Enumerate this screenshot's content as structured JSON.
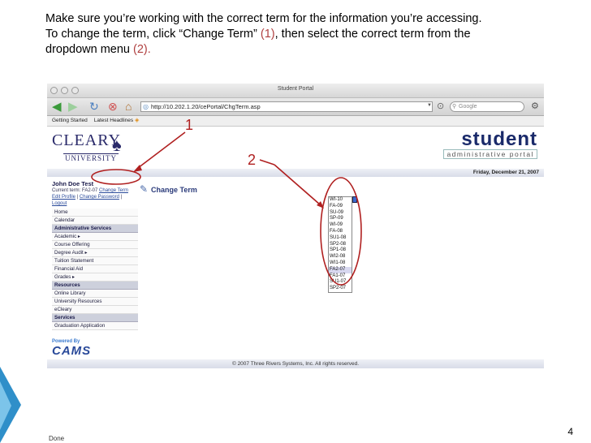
{
  "instructions": {
    "line1": "Make sure you’re working with the correct term for the information you’re accessing.",
    "line2_pre": "To change the term, click “Change Term” ",
    "line2_ref1": "(1)",
    "line2_post": ", then select the correct term from the",
    "line3_pre": "dropdown menu ",
    "line3_ref2": "(2)."
  },
  "browser": {
    "window_title": "Student Portal",
    "url": "http://10.202.1.20/cePortal/ChgTerm.asp",
    "search_placeholder": "Google",
    "bookmarks": [
      "Getting Started",
      "Latest Headlines"
    ],
    "status": "Done"
  },
  "portal": {
    "logo_name": "CLEARY",
    "logo_sub": "UNIVERSITY",
    "brand_title": "student",
    "brand_subtitle": "administrative portal",
    "date": "Friday, December 21, 2007",
    "user_name": "John Doe Test",
    "current_term_label": "Current term:",
    "current_term_value": "FA2-07",
    "change_term_link": "Change Term",
    "edit_profile_link": "Edit Profile",
    "change_password_link": "Change Password",
    "logout_link": "Logout",
    "page_title": "Change Term",
    "menu": [
      {
        "label": "Home",
        "type": "item"
      },
      {
        "label": "Calendar",
        "type": "item"
      },
      {
        "label": "Administrative Services",
        "type": "head"
      },
      {
        "label": "Academic ▸",
        "type": "item"
      },
      {
        "label": "Course Offering",
        "type": "item"
      },
      {
        "label": "Degree Audit ▸",
        "type": "item"
      },
      {
        "label": "Tuition Statement",
        "type": "item"
      },
      {
        "label": "Financial Aid",
        "type": "item"
      },
      {
        "label": "Grades ▸",
        "type": "item"
      },
      {
        "label": "Resources",
        "type": "head"
      },
      {
        "label": "Online Library",
        "type": "item"
      },
      {
        "label": "University Resources",
        "type": "item"
      },
      {
        "label": "eCleary",
        "type": "item"
      },
      {
        "label": "Services",
        "type": "head"
      },
      {
        "label": "Graduation Application",
        "type": "item"
      }
    ],
    "powered_by": "Powered By",
    "cams": "CAMS",
    "terms": [
      "WI-10",
      "FA-09",
      "SU-09",
      "SP-09",
      "WI-09",
      "FA-08",
      "SU1-08",
      "SP2-08",
      "SP1-08",
      "WI2-08",
      "WI1-08",
      "FA2-07",
      "FA1-07",
      "SU1-07",
      "SP2-07"
    ],
    "selected_term": "FA2-07",
    "footer": "© 2007 Three Rivers Systems, Inc. All rights reserved."
  },
  "annotations": {
    "label1": "1",
    "label2": "2",
    "color": "#b02020"
  },
  "slide_number": "4"
}
